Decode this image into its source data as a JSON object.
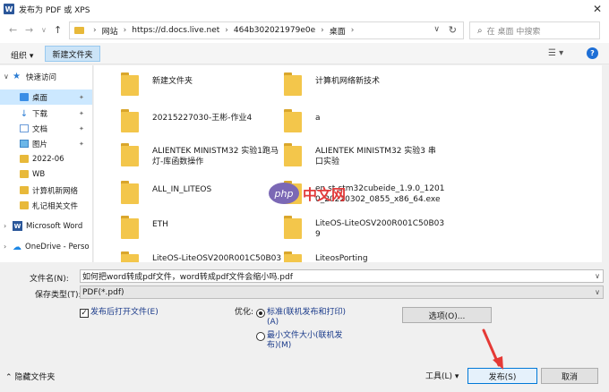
{
  "window": {
    "title": "发布为 PDF 或 XPS",
    "app_icon": "W"
  },
  "nav": {
    "breadcrumb": [
      "网站",
      "https://d.docs.live.net",
      "464b302021979e0e",
      "桌面"
    ],
    "search_placeholder": "在 桌面 中搜索"
  },
  "toolbar": {
    "organize": "组织",
    "new_folder": "新建文件夹"
  },
  "sidebar": {
    "quick_access": "快速访问",
    "items": [
      {
        "label": "桌面",
        "icon": "desktop-icon"
      },
      {
        "label": "下载",
        "icon": "download-icon"
      },
      {
        "label": "文档",
        "icon": "document-icon"
      },
      {
        "label": "图片",
        "icon": "picture-icon"
      },
      {
        "label": "2022-06",
        "icon": "folder-icon"
      },
      {
        "label": "WB",
        "icon": "folder-icon"
      },
      {
        "label": "计算机新网络",
        "icon": "folder-icon"
      },
      {
        "label": "札记相关文件",
        "icon": "folder-icon"
      }
    ],
    "word": "Microsoft Word",
    "onedrive": "OneDrive - Perso"
  },
  "files": [
    {
      "name_lines": [
        "新建文件夹"
      ]
    },
    {
      "name_lines": [
        "计算机网络新技术"
      ]
    },
    {
      "name_lines": [
        "20215227030-王彬-作业4"
      ]
    },
    {
      "name_lines": [
        "a"
      ]
    },
    {
      "name_lines": [
        "ALIENTEK MINISTM32 实验1跑马",
        "灯-库函数操作"
      ]
    },
    {
      "name_lines": [
        "ALIENTEK MINISTM32 实验3 串",
        "口实验"
      ]
    },
    {
      "name_lines": [
        "ALL_IN_LITEOS"
      ]
    },
    {
      "name_lines": [
        "en.st-stm32cubeide_1.9.0_1201",
        "0_20220302_0855_x86_64.exe"
      ]
    },
    {
      "name_lines": [
        "ETH"
      ]
    },
    {
      "name_lines": [
        "LiteOS-LiteOSV200R001C50B03",
        "9"
      ]
    },
    {
      "name_lines": [
        "LiteOS-LiteOSV200R001C50B03"
      ]
    },
    {
      "name_lines": [
        "LiteosPorting"
      ]
    }
  ],
  "watermark": {
    "logo": "php",
    "text": "中文网"
  },
  "form": {
    "filename_label": "文件名(N):",
    "filename_value": "如何把word转成pdf文件，word转成pdf文件会缩小吗.pdf",
    "filetype_label": "保存类型(T):",
    "filetype_value": "PDF(*.pdf)",
    "open_after_publish": "发布后打开文件(E)",
    "optimize_label": "优化:",
    "opt_standard_1": "标准(联机发布和打印)",
    "opt_standard_2": "(A)",
    "opt_min_1": "最小文件大小(联机发",
    "opt_min_2": "布)(M)",
    "options_button": "选项(O)...",
    "hide_folders": "隐藏文件夹",
    "tools": "工具(L)",
    "publish": "发布(S)",
    "cancel": "取消"
  },
  "colors": {
    "accent": "#0078d7",
    "folder": "#f3c64b",
    "annotation_arrow": "#e53935"
  }
}
